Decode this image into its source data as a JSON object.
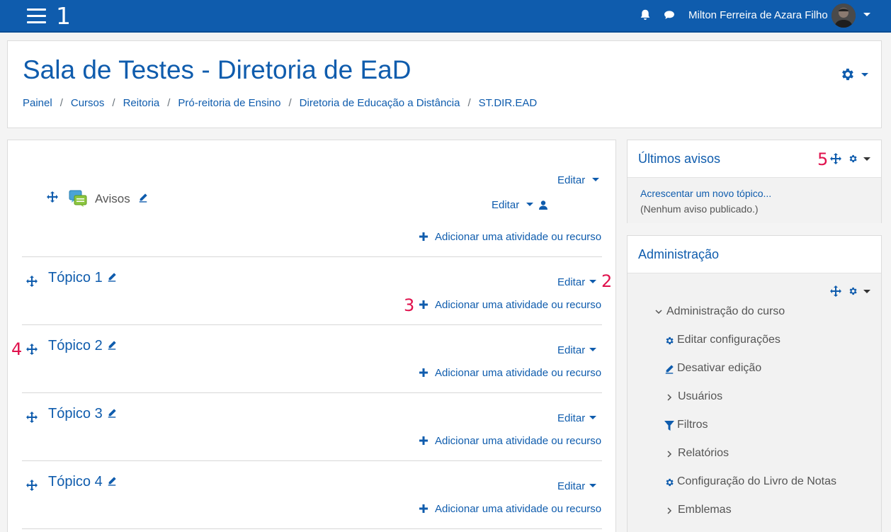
{
  "navbar": {
    "marker": "1",
    "user_name": "Milton Ferreira de Azara Filho"
  },
  "header": {
    "title": "Sala de Testes - Diretoria de EaD",
    "breadcrumb": [
      "Painel",
      "Cursos",
      "Reitoria",
      "Pró-reitoria de Ensino",
      "Diretoria de Educação a Distância",
      "ST.DIR.EAD"
    ]
  },
  "course": {
    "section0": {
      "edit_label": "Editar",
      "activity_name": "Avisos",
      "activity_edit_label": "Editar",
      "add_label": "Adicionar uma atividade ou recurso"
    },
    "topics": [
      {
        "title": "Tópico 1",
        "edit_label": "Editar",
        "add_label": "Adicionar uma atividade ou recurso"
      },
      {
        "title": "Tópico 2",
        "edit_label": "Editar",
        "add_label": "Adicionar uma atividade ou recurso"
      },
      {
        "title": "Tópico 3",
        "edit_label": "Editar",
        "add_label": "Adicionar uma atividade ou recurso"
      },
      {
        "title": "Tópico 4",
        "edit_label": "Editar",
        "add_label": "Adicionar uma atividade ou recurso"
      }
    ],
    "markers": {
      "edit": "2",
      "add": "3",
      "move": "4"
    }
  },
  "blocks": {
    "news": {
      "title": "Últimos avisos",
      "marker": "5",
      "add_topic": "Acrescentar um novo tópico...",
      "empty": "(Nenhum aviso publicado.)"
    },
    "admin": {
      "title": "Administração",
      "root": "Administração do curso",
      "items": [
        {
          "label": "Editar configurações",
          "icon": "gear-icon"
        },
        {
          "label": "Desativar edição",
          "icon": "pencil-icon"
        },
        {
          "label": "Usuários",
          "icon": "chevron-right-icon"
        },
        {
          "label": "Filtros",
          "icon": "filter-icon"
        },
        {
          "label": "Relatórios",
          "icon": "chevron-right-icon"
        },
        {
          "label": "Configuração do Livro de Notas",
          "icon": "gear-icon"
        },
        {
          "label": "Emblemas",
          "icon": "chevron-right-icon"
        }
      ]
    }
  },
  "colors": {
    "brand": "#0f5cad",
    "marker": "#e0124d"
  }
}
